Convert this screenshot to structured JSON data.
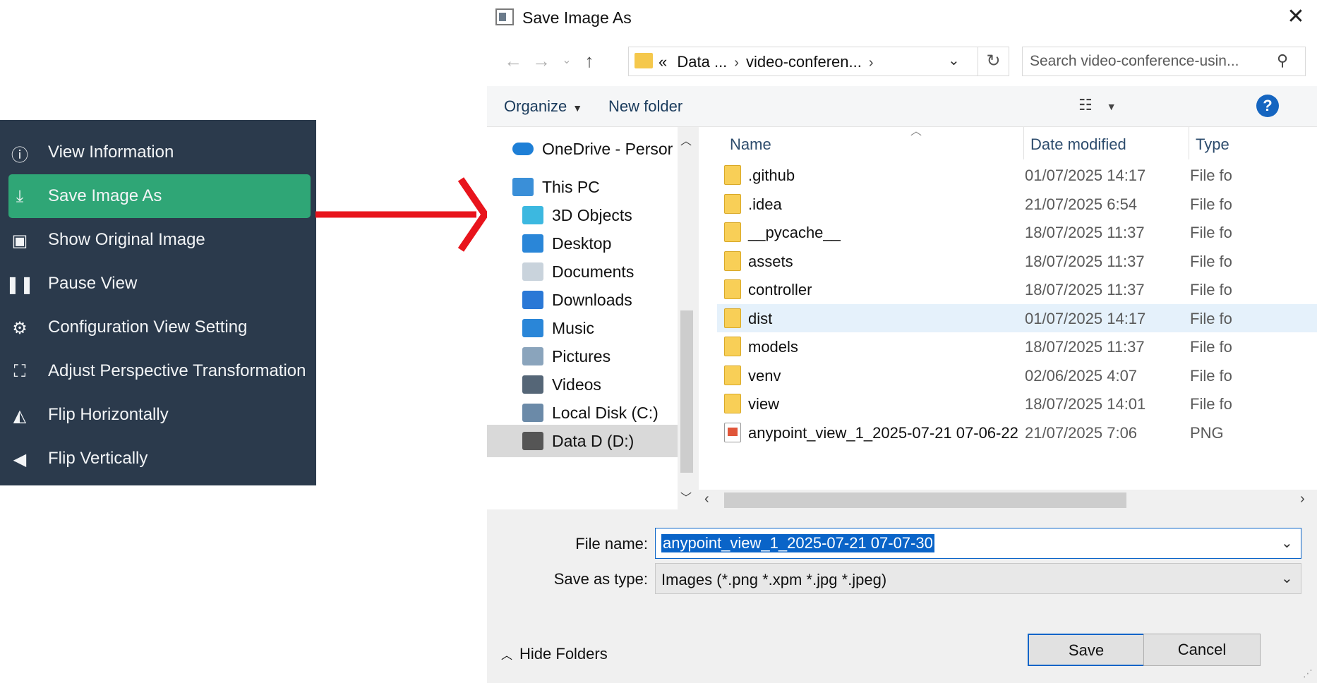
{
  "menu": {
    "items": [
      {
        "label": "View Information",
        "icon": "info-icon",
        "glyph": "ⓘ",
        "active": false
      },
      {
        "label": "Save Image As",
        "icon": "download-icon",
        "glyph": "⤓",
        "active": true
      },
      {
        "label": "Show Original Image",
        "icon": "image-icon",
        "glyph": "▣",
        "active": false
      },
      {
        "label": "Pause View",
        "icon": "pause-icon",
        "glyph": "❚❚",
        "active": false
      },
      {
        "label": "Configuration View Setting",
        "icon": "gear-icon",
        "glyph": "⚙",
        "active": false
      },
      {
        "label": "Adjust Perspective Transformation",
        "icon": "perspective-icon",
        "glyph": "⛶",
        "active": false
      },
      {
        "label": "Flip Horizontally",
        "icon": "flip-horizontal-icon",
        "glyph": "◭",
        "active": false
      },
      {
        "label": "Flip Vertically",
        "icon": "flip-vertical-icon",
        "glyph": "◀",
        "active": false
      }
    ],
    "colors": {
      "background": "#2b3a4c",
      "active": "#2fa676"
    }
  },
  "arrow": {
    "color": "#e8141c"
  },
  "dialog": {
    "title": "Save Image As",
    "address": {
      "crumb_prefix": "«",
      "crumbs": [
        "Data ...",
        "video-conferen..."
      ]
    },
    "search": {
      "placeholder": "Search video-conference-usin..."
    },
    "toolbar": {
      "organize": "Organize",
      "new_folder": "New folder",
      "help": "?"
    },
    "nav": [
      {
        "label": "OneDrive - Persor",
        "icon": "onedrive-icon",
        "indent": 0,
        "selected": false
      },
      {
        "label": "This PC",
        "icon": "this-pc-icon",
        "indent": 0,
        "selected": false
      },
      {
        "label": "3D Objects",
        "icon": "3d-objects-icon",
        "indent": 1,
        "selected": false
      },
      {
        "label": "Desktop",
        "icon": "desktop-icon",
        "indent": 1,
        "selected": false
      },
      {
        "label": "Documents",
        "icon": "documents-icon",
        "indent": 1,
        "selected": false
      },
      {
        "label": "Downloads",
        "icon": "downloads-icon",
        "indent": 1,
        "selected": false
      },
      {
        "label": "Music",
        "icon": "music-icon",
        "indent": 1,
        "selected": false
      },
      {
        "label": "Pictures",
        "icon": "pictures-icon",
        "indent": 1,
        "selected": false
      },
      {
        "label": "Videos",
        "icon": "videos-icon",
        "indent": 1,
        "selected": false
      },
      {
        "label": "Local Disk (C:)",
        "icon": "local-disk-icon",
        "indent": 1,
        "selected": false
      },
      {
        "label": "Data D (D:)",
        "icon": "data-drive-icon",
        "indent": 1,
        "selected": true
      }
    ],
    "columns": {
      "name": "Name",
      "date": "Date modified",
      "type": "Type"
    },
    "files": [
      {
        "name": ".github",
        "date": "01/07/2025 14:17",
        "type": "File fo",
        "kind": "folder",
        "selected": false
      },
      {
        "name": ".idea",
        "date": "21/07/2025 6:54",
        "type": "File fo",
        "kind": "folder",
        "selected": false
      },
      {
        "name": "__pycache__",
        "date": "18/07/2025 11:37",
        "type": "File fo",
        "kind": "folder",
        "selected": false
      },
      {
        "name": "assets",
        "date": "18/07/2025 11:37",
        "type": "File fo",
        "kind": "folder",
        "selected": false
      },
      {
        "name": "controller",
        "date": "18/07/2025 11:37",
        "type": "File fo",
        "kind": "folder",
        "selected": false
      },
      {
        "name": "dist",
        "date": "01/07/2025 14:17",
        "type": "File fo",
        "kind": "folder",
        "selected": true
      },
      {
        "name": "models",
        "date": "18/07/2025 11:37",
        "type": "File fo",
        "kind": "folder",
        "selected": false
      },
      {
        "name": "venv",
        "date": "02/06/2025 4:07",
        "type": "File fo",
        "kind": "folder",
        "selected": false
      },
      {
        "name": "view",
        "date": "18/07/2025 14:01",
        "type": "File fo",
        "kind": "folder",
        "selected": false
      },
      {
        "name": "anypoint_view_1_2025-07-21 07-06-22",
        "date": "21/07/2025 7:06",
        "type": "PNG",
        "kind": "png",
        "selected": false
      }
    ],
    "form": {
      "file_name_label": "File name:",
      "file_name_value": "anypoint_view_1_2025-07-21 07-07-30",
      "save_type_label": "Save as type:",
      "save_type_value": "Images (*.png *.xpm *.jpg *.jpeg)"
    },
    "footer": {
      "hide_folders": "Hide Folders",
      "save": "Save",
      "cancel": "Cancel"
    }
  }
}
